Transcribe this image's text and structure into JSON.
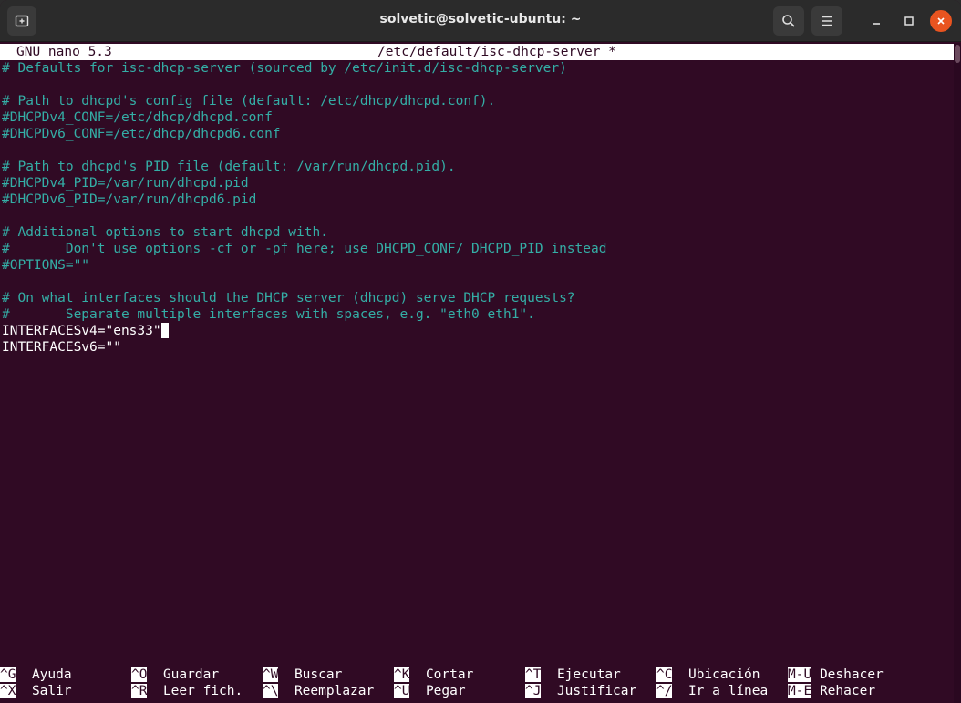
{
  "window": {
    "title": "solvetic@solvetic-ubuntu: ~"
  },
  "icons": {
    "new_tab": "new-tab-icon",
    "search": "search-icon",
    "menu": "hamburger-menu-icon",
    "minimize": "minimize-icon",
    "maximize": "maximize-icon",
    "close": "close-icon"
  },
  "colors": {
    "terminal_bg": "#300a24",
    "comment": "#34aea6",
    "text": "#ffffff",
    "close_button": "#e95420"
  },
  "nano": {
    "version": "GNU nano 5.3",
    "filename": "/etc/default/isc-dhcp-server *"
  },
  "lines": [
    {
      "text": "# Defaults for isc-dhcp-server (sourced by /etc/init.d/isc-dhcp-server)",
      "type": "comment"
    },
    {
      "text": "",
      "type": "blank"
    },
    {
      "text": "# Path to dhcpd's config file (default: /etc/dhcp/dhcpd.conf).",
      "type": "comment"
    },
    {
      "text": "#DHCPDv4_CONF=/etc/dhcp/dhcpd.conf",
      "type": "comment"
    },
    {
      "text": "#DHCPDv6_CONF=/etc/dhcp/dhcpd6.conf",
      "type": "comment"
    },
    {
      "text": "",
      "type": "blank"
    },
    {
      "text": "# Path to dhcpd's PID file (default: /var/run/dhcpd.pid).",
      "type": "comment"
    },
    {
      "text": "#DHCPDv4_PID=/var/run/dhcpd.pid",
      "type": "comment"
    },
    {
      "text": "#DHCPDv6_PID=/var/run/dhcpd6.pid",
      "type": "comment"
    },
    {
      "text": "",
      "type": "blank"
    },
    {
      "text": "# Additional options to start dhcpd with.",
      "type": "comment"
    },
    {
      "text": "#       Don't use options -cf or -pf here; use DHCPD_CONF/ DHCPD_PID instead",
      "type": "comment"
    },
    {
      "text": "#OPTIONS=\"\"",
      "type": "comment"
    },
    {
      "text": "",
      "type": "blank"
    },
    {
      "text": "# On what interfaces should the DHCP server (dhcpd) serve DHCP requests?",
      "type": "comment"
    },
    {
      "text": "#       Separate multiple interfaces with spaces, e.g. \"eth0 eth1\".",
      "type": "comment"
    },
    {
      "text": "INTERFACESv4=\"ens33\"",
      "type": "text",
      "cursor": true
    },
    {
      "text": "INTERFACESv6=\"\"",
      "type": "text"
    }
  ],
  "shortcuts": [
    {
      "key": "^G",
      "label": "Ayuda"
    },
    {
      "key": "^O",
      "label": "Guardar"
    },
    {
      "key": "^W",
      "label": "Buscar"
    },
    {
      "key": "^K",
      "label": "Cortar"
    },
    {
      "key": "^T",
      "label": "Ejecutar"
    },
    {
      "key": "^C",
      "label": "Ubicación"
    },
    {
      "key": "M-U",
      "label": "Deshacer"
    },
    {
      "key": "^X",
      "label": "Salir"
    },
    {
      "key": "^R",
      "label": "Leer fich."
    },
    {
      "key": "^\\",
      "label": "Reemplazar"
    },
    {
      "key": "^U",
      "label": "Pegar"
    },
    {
      "key": "^J",
      "label": "Justificar"
    },
    {
      "key": "^/",
      "label": "Ir a línea"
    },
    {
      "key": "M-E",
      "label": "Rehacer"
    }
  ]
}
